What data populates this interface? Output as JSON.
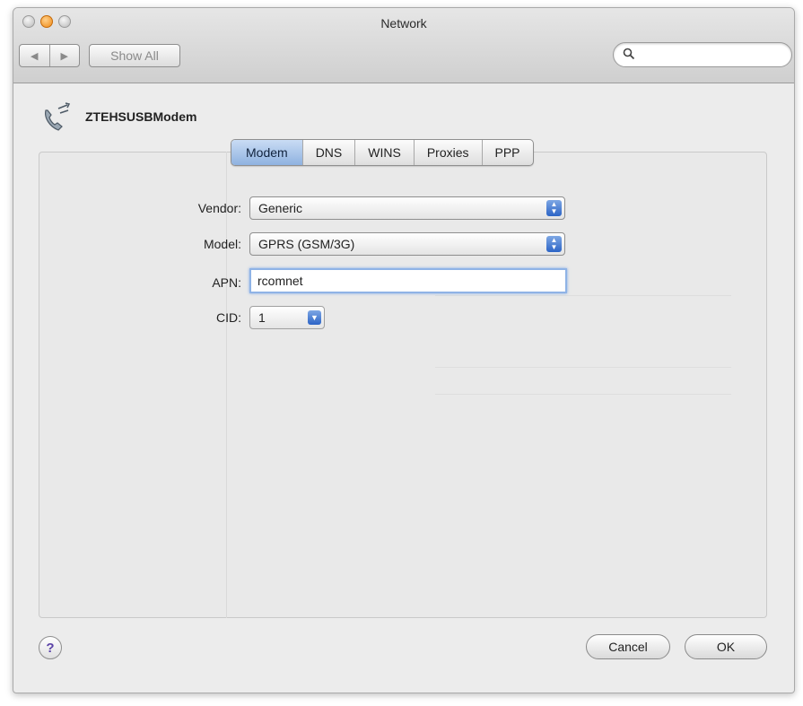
{
  "window": {
    "title": "Network"
  },
  "toolbar": {
    "back_glyph": "◀",
    "forward_glyph": "▶",
    "show_all_label": "Show All",
    "search": {
      "icon": "search-icon",
      "value": "",
      "placeholder": ""
    }
  },
  "device": {
    "icon": "phone-modem-icon",
    "name": "ZTEHSUSBModem"
  },
  "tabs": [
    {
      "label": "Modem",
      "active": true
    },
    {
      "label": "DNS",
      "active": false
    },
    {
      "label": "WINS",
      "active": false
    },
    {
      "label": "Proxies",
      "active": false
    },
    {
      "label": "PPP",
      "active": false
    }
  ],
  "form": {
    "vendor": {
      "label": "Vendor:",
      "value": "Generic"
    },
    "model": {
      "label": "Model:",
      "value": "GPRS (GSM/3G)"
    },
    "apn": {
      "label": "APN:",
      "value": "rcomnet"
    },
    "cid": {
      "label": "CID:",
      "value": "1"
    }
  },
  "footer": {
    "help_glyph": "?",
    "cancel_label": "Cancel",
    "ok_label": "OK"
  },
  "colors": {
    "active_tab": "#8fb2e0",
    "focus_ring": "#7aa6e8",
    "window_bg": "#ececec"
  }
}
